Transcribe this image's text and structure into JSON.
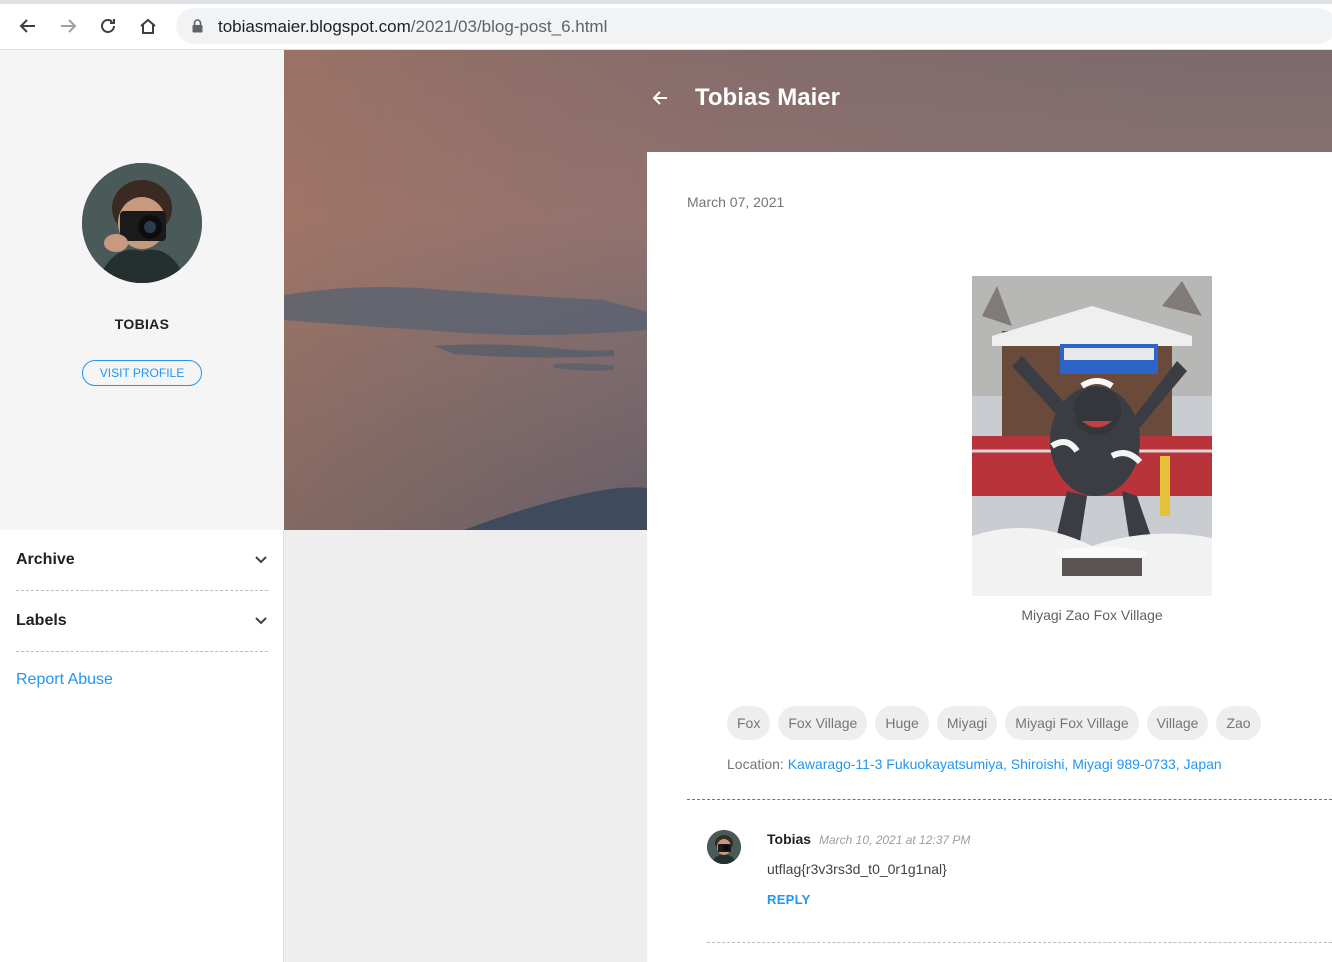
{
  "browser": {
    "url_host": "tobiasmaier.blogspot.com",
    "url_path": "/2021/03/blog-post_6.html"
  },
  "profile": {
    "name": "TOBIAS",
    "visit_label": "VISIT PROFILE"
  },
  "sidebar": {
    "sections": [
      {
        "label": "Archive"
      },
      {
        "label": "Labels"
      }
    ],
    "report_label": "Report Abuse"
  },
  "blog": {
    "title": "Tobias Maier"
  },
  "post": {
    "date": "March 07, 2021",
    "caption": "Miyagi Zao Fox Village",
    "labels": [
      "Fox",
      "Fox Village",
      "Huge",
      "Miyagi",
      "Miyagi Fox Village",
      "Village",
      "Zao"
    ],
    "location_prefix": "Location:",
    "location_link": "Kawarago-11-3 Fukuokayatsumiya, Shiroishi, Miyagi 989-0733, Japan"
  },
  "comment": {
    "author": "Tobias",
    "time": "March 10, 2021 at 12:37 PM",
    "body": "utflag{r3v3rs3d_t0_0r1g1nal}",
    "reply_label": "REPLY"
  },
  "colors": {
    "accent": "#2196f3",
    "sidebar_bg": "#f5f5f5",
    "gray_area": "#eeeeee"
  }
}
